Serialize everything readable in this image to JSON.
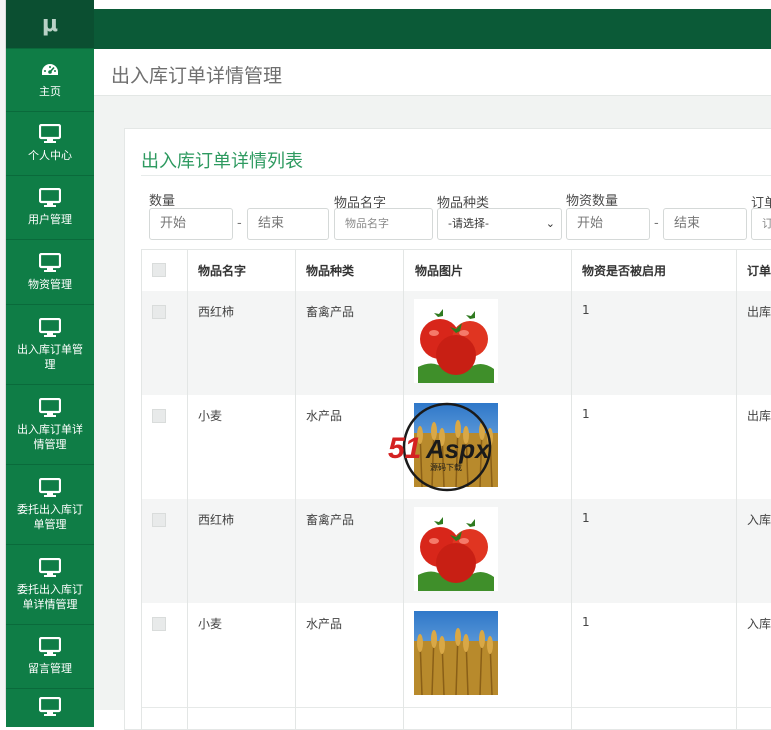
{
  "sidebar": {
    "logo": "μ",
    "items": [
      {
        "label": "主页",
        "icon": "dashboard-icon"
      },
      {
        "label": "个人中心",
        "icon": "monitor-icon"
      },
      {
        "label": "用户管理",
        "icon": "monitor-icon"
      },
      {
        "label": "物资管理",
        "icon": "monitor-icon"
      },
      {
        "label": "出入库订单管理",
        "icon": "monitor-icon"
      },
      {
        "label": "出入库订单详情管理",
        "icon": "monitor-icon"
      },
      {
        "label": "委托出入库订单管理",
        "icon": "monitor-icon"
      },
      {
        "label": "委托出入库订单详情管理",
        "icon": "monitor-icon"
      },
      {
        "label": "留言管理",
        "icon": "monitor-icon"
      },
      {
        "label": "",
        "icon": "monitor-icon"
      }
    ]
  },
  "page": {
    "title": "出入库订单详情管理",
    "panel_title": "出入库订单详情列表"
  },
  "filters": {
    "quantity_label": "数量",
    "quantity_start": "开始",
    "dash1": "-",
    "quantity_end": "结束",
    "name_label": "物品名字",
    "name_placeholder": "物品名字",
    "type_label": "物品种类",
    "type_selected": "-请选择-",
    "stock_label": "物资数量",
    "stock_start": "开始",
    "dash2": "-",
    "stock_end": "结束",
    "order_label": "订单",
    "order_placeholder": "订"
  },
  "table": {
    "columns": [
      "物品名字",
      "物品种类",
      "物品图片",
      "物资是否被启用",
      "订单"
    ],
    "rows": [
      {
        "name": "西红柿",
        "type": "畜禽产品",
        "image": "tomato-image",
        "enabled": "1",
        "order": "出库"
      },
      {
        "name": "小麦",
        "type": "水产品",
        "image": "wheat-image",
        "enabled": "1",
        "order": "出库"
      },
      {
        "name": "西红柿",
        "type": "畜禽产品",
        "image": "tomato-image",
        "enabled": "1",
        "order": "入库"
      },
      {
        "name": "小麦",
        "type": "水产品",
        "image": "wheat-image",
        "enabled": "1",
        "order": "入库"
      }
    ]
  },
  "watermark": {
    "brand": "51Aspx",
    "sub": "源码下载"
  },
  "colors": {
    "sidebar": "#0f7d46",
    "topbar": "#0b5a37",
    "accent": "#2e9a60"
  }
}
